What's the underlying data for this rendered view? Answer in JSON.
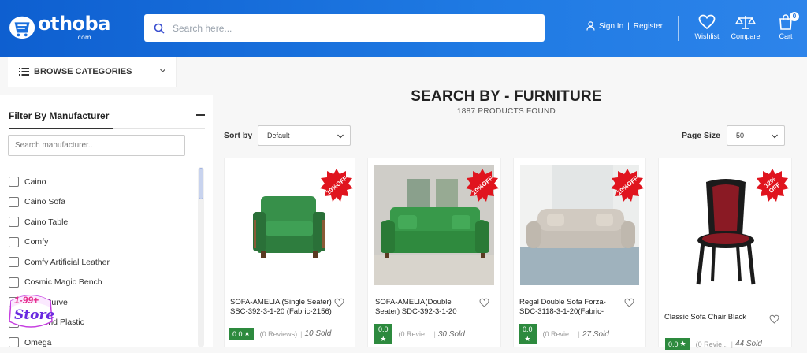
{
  "brand": {
    "name": "othoba",
    "suffix": ".com"
  },
  "search": {
    "placeholder": "Search here..."
  },
  "auth": {
    "sign_in": "Sign In",
    "separator": "|",
    "register": "Register"
  },
  "header_actions": [
    {
      "label": "Wishlist",
      "icon": "heart-icon"
    },
    {
      "label": "Compare",
      "icon": "scale-icon"
    },
    {
      "label": "Cart",
      "icon": "bag-icon",
      "badge": "0"
    }
  ],
  "browse": {
    "label": "BROWSE CATEGORIES"
  },
  "filter": {
    "title": "Filter By Manufacturer",
    "search_placeholder": "Search manufacturer..",
    "manufacturers": [
      "Caino",
      "Caino Sofa",
      "Caino Table",
      "Comfy",
      "Comfy Artificial Leather",
      "Cosmic Magic Bench",
      "Cozy Curve",
      "Diamond Plastic",
      "Omega"
    ]
  },
  "store_badge": {
    "price": "1-99+",
    "label": "Store"
  },
  "main": {
    "title": "SEARCH BY - FURNITURE",
    "count": "1887 PRODUCTS FOUND",
    "sort_label": "Sort by",
    "sort_value": "Default",
    "page_size_label": "Page Size",
    "page_size_value": "50"
  },
  "products": [
    {
      "name_line1": "SOFA-AMELIA (Single Seater)",
      "name_line2": "SSC-392-3-1-20 (Fabric-2156)",
      "rating": "0.0",
      "reviews": "(0 Reviews)",
      "sold": "10 Sold",
      "discount_line1": "10%",
      "discount_line2": "OFF"
    },
    {
      "name_line1": "SOFA-AMELIA(Double",
      "name_line2": "Seater) SDC-392-3-1-20",
      "rating": "0.0",
      "reviews": "(0 Revie...",
      "sold": "30 Sold",
      "discount_line1": "10%",
      "discount_line2": "OFF"
    },
    {
      "name_line1": "Regal Double Sofa Forza-",
      "name_line2": "SDC-3118-3-1-20(Fabric-",
      "rating": "0.0",
      "reviews": "(0 Revie...",
      "sold": "27 Sold",
      "discount_line1": "10%",
      "discount_line2": "OFF"
    },
    {
      "name_line1": "Classic Sofa Chair Black",
      "name_line2": "",
      "rating": "0.0",
      "reviews": "(0 Revie...",
      "sold": "44 Sold",
      "discount_line1": "12%",
      "discount_line2": "OFF"
    }
  ],
  "colors": {
    "header": "#1a6fdd",
    "discount": "#e0141e",
    "rating": "#2d8a3e"
  }
}
